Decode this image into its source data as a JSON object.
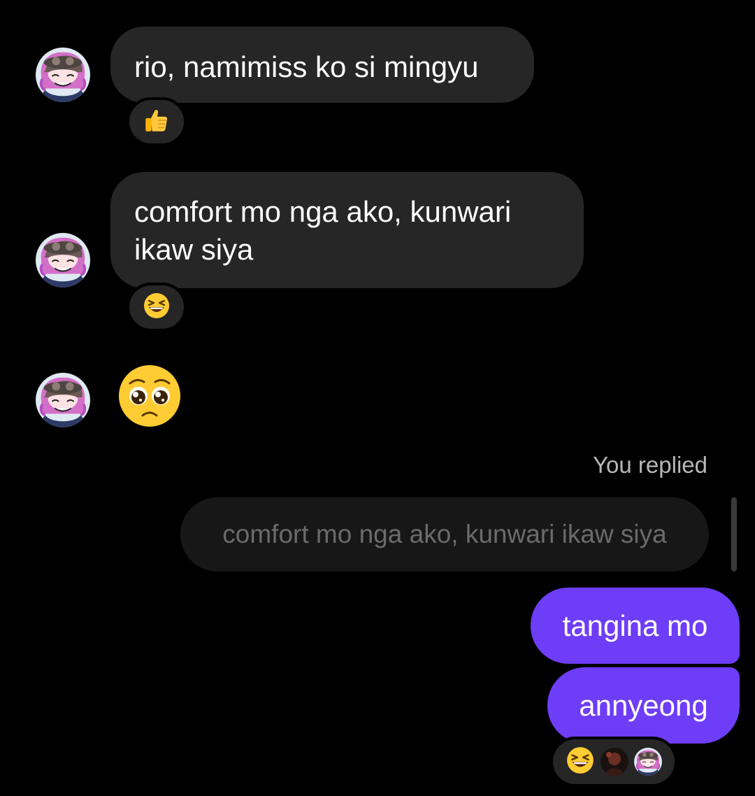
{
  "messages": {
    "m1": {
      "text": "rio, namimiss ko si mingyu",
      "reaction_icon": "thumbs-up-icon"
    },
    "m2": {
      "text": "comfort mo nga ako, kunwari ikaw siya",
      "reaction_icon": "grinning-squinting-face-icon"
    },
    "m3": {
      "emoji_icon": "pleading-face-icon"
    }
  },
  "reply": {
    "label": "You replied",
    "quote": "comfort mo nga ako, kunwari ikaw siya"
  },
  "sent": {
    "first": "tangina mo",
    "second": "annyeong",
    "reaction_icon": "grinning-squinting-face-icon",
    "reactor_avatars": [
      "dark-avatar-icon",
      "pink-hair-avatar-icon"
    ]
  },
  "colors": {
    "background": "#000000",
    "incoming_bubble": "#262626",
    "outgoing_bubble": "#6e3df7",
    "quote_bubble": "#171717",
    "muted_text": "#b8b8b8"
  }
}
